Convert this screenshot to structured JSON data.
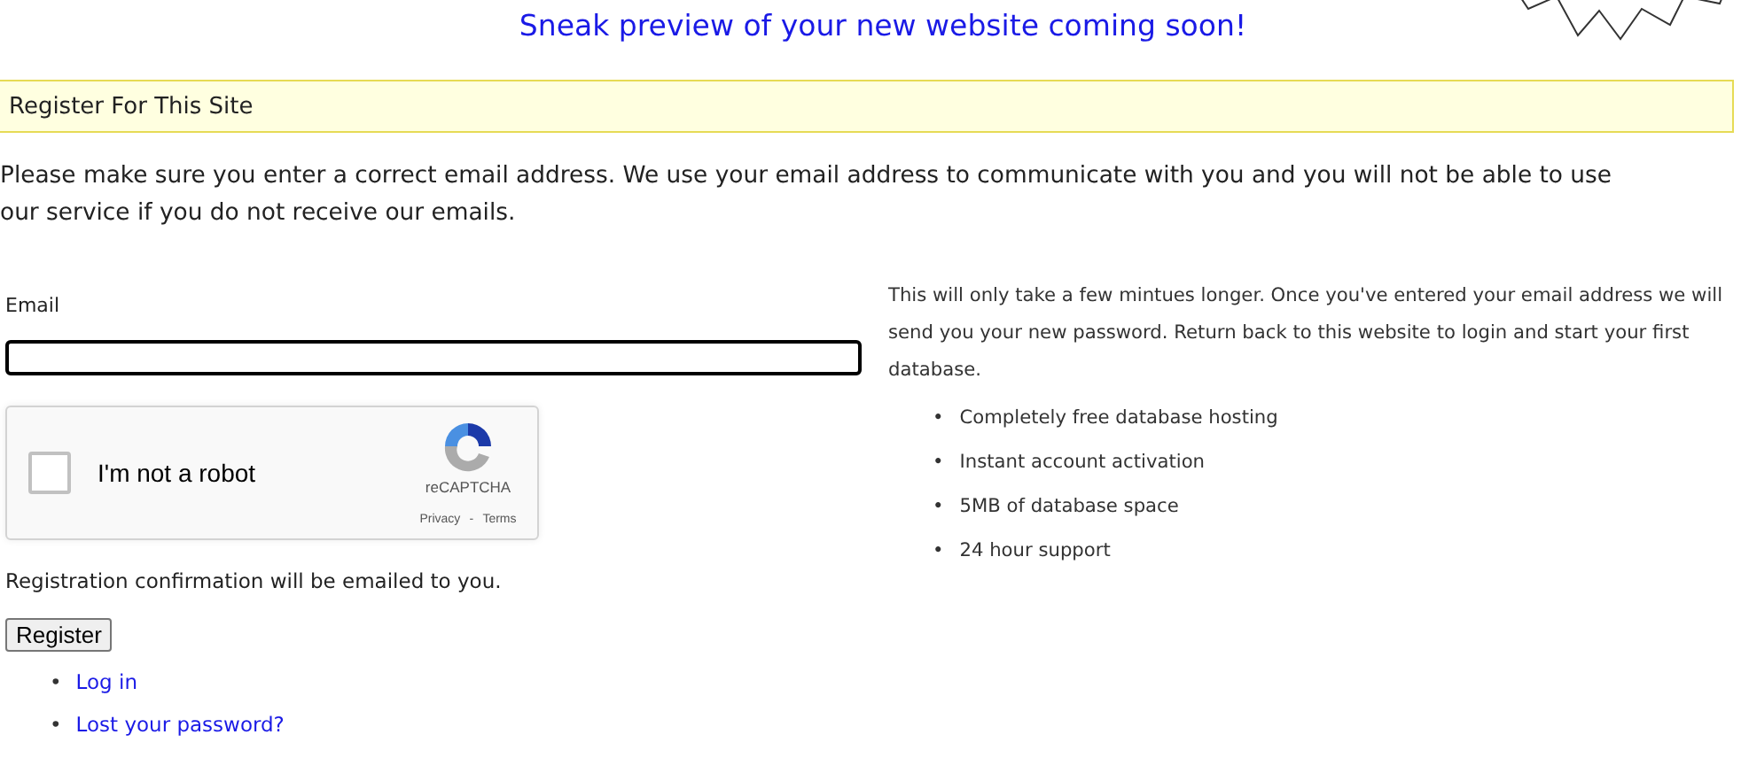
{
  "headline": "Sneak preview of your new website coming soon!",
  "banner": {
    "title": "Register For This Site"
  },
  "intro": [
    "Please make sure you enter a correct email address. We use your email address to communicate with you and you will not be able to use",
    "our service if you do not receive our emails."
  ],
  "bullet": "•",
  "form": {
    "email_label": "Email",
    "captcha": {
      "checked": false,
      "label": "I'm not a robot",
      "brand": "reCAPTCHA",
      "privacy": "Privacy",
      "separator": "-",
      "terms": "Terms"
    },
    "confirmation": "Registration confirmation will be emailed to you.",
    "submit": "Register",
    "links": [
      "Log in",
      "Lost your password?"
    ]
  },
  "info": {
    "text": "This will only take a few mintues longer. Once you've entered your email address we will send you your new password. Return back to this website to login and start your first database.",
    "features": [
      "Completely free database hosting",
      "Instant account activation",
      "5MB of database space",
      "24 hour support"
    ]
  }
}
